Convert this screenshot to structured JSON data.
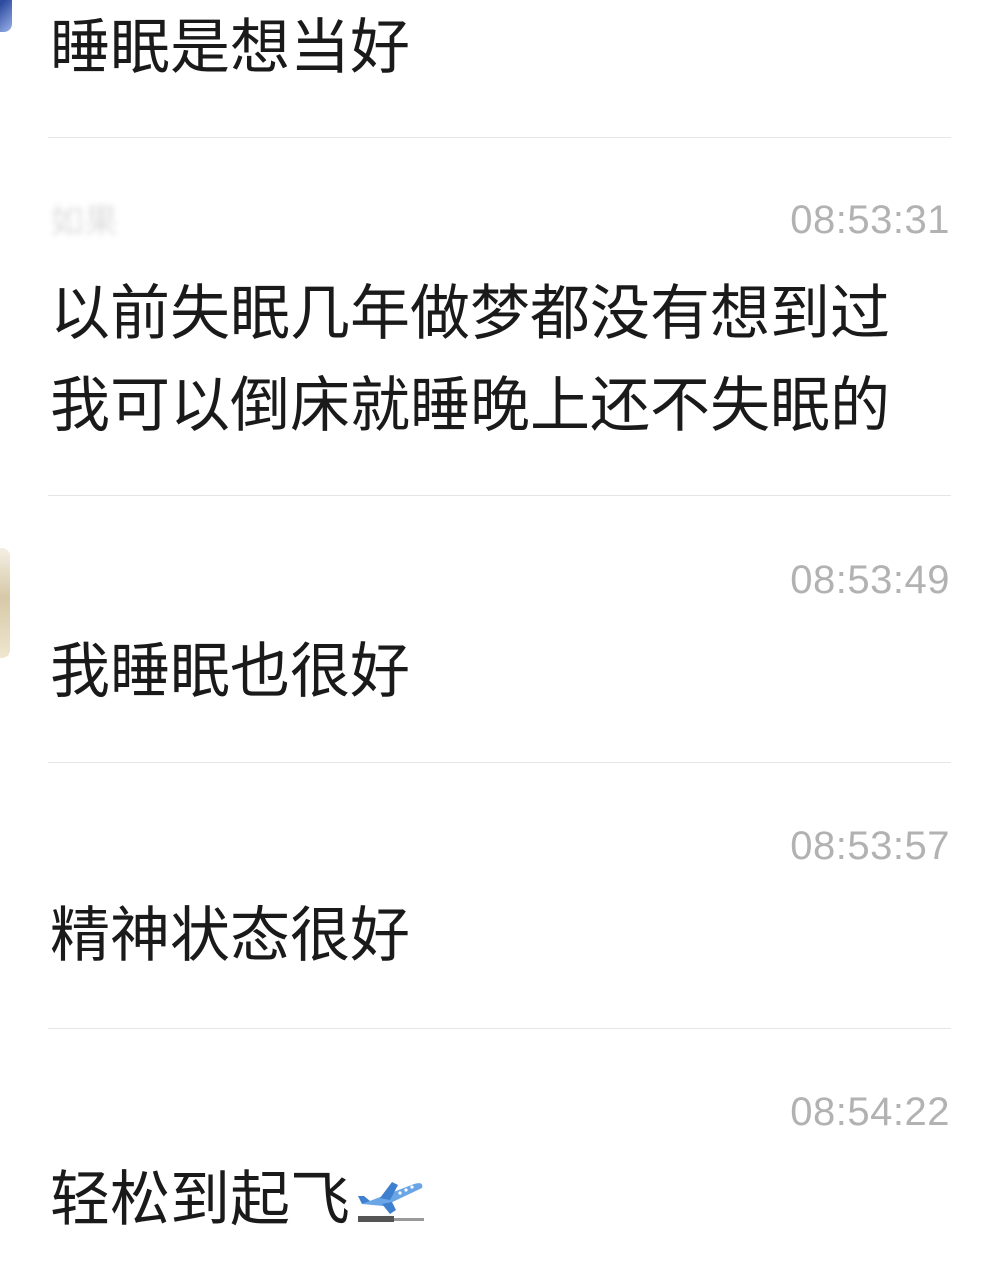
{
  "messages": [
    {
      "sender": "",
      "time": "",
      "text": "睡眠是想当好"
    },
    {
      "sender": "如果",
      "time": "08:53:31",
      "text_line1": "以前失眠几年做梦都没有想到过",
      "text_line2": "我可以倒床就睡晚上还不失眠的"
    },
    {
      "sender": "",
      "time": "08:53:49",
      "text": "我睡眠也很好"
    },
    {
      "sender": "",
      "time": "08:53:57",
      "text": "精神状态很好"
    },
    {
      "sender": "",
      "time": "08:54:22",
      "text": "轻松到起飞",
      "emoji": "airplane-departure-icon"
    }
  ],
  "colors": {
    "background": "#ffffff",
    "message_text": "#1a1a1a",
    "timestamp": "#b2b2b2",
    "divider": "#e6e6e6"
  }
}
